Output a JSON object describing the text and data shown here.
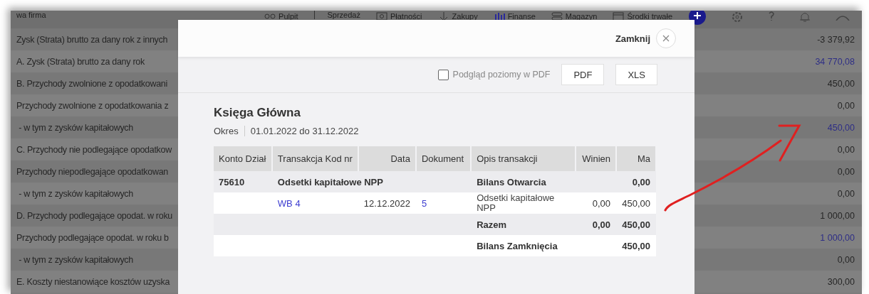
{
  "top_nav": {
    "company": "wa firma",
    "items": [
      {
        "kind": "desk",
        "label": "Pulpit"
      },
      {
        "kind": "none",
        "label": "Sprzedaż"
      },
      {
        "kind": "payment",
        "label": "Płatności"
      },
      {
        "kind": "down",
        "label": "Zakupy"
      },
      {
        "kind": "bars",
        "label": "Finanse"
      },
      {
        "kind": "stack",
        "label": "Magazyn"
      },
      {
        "kind": "calendar",
        "label": "Środki trwałe"
      }
    ]
  },
  "report_rows": [
    {
      "label": "Zysk (Strata) brutto za dany rok z innych",
      "value": "-3 379,92",
      "link": false
    },
    {
      "label": "A. Zysk (Strata) brutto za dany rok",
      "value": "34 770,08",
      "link": true
    },
    {
      "label": "B. Przychody zwolnione z opodatkowani",
      "value": "450,00",
      "link": false
    },
    {
      "label": "Przychody zwolnione z opodatkowania z",
      "value": "0,00",
      "link": false
    },
    {
      "label": " - w tym z zysków kapitałowych",
      "value": "450,00",
      "link": true
    },
    {
      "label": "C. Przychody nie podlegające opodatkow",
      "value": "0,00",
      "link": false
    },
    {
      "label": "Przychody niepodlegające opodatkowan",
      "value": "0,00",
      "link": false
    },
    {
      "label": " - w tym z zysków kapitałowych",
      "value": "0,00",
      "link": false
    },
    {
      "label": "D. Przychody podlegające opodat. w roku",
      "value": "1 000,00",
      "link": false
    },
    {
      "label": "Przychody podlegające opodat. w roku b",
      "value": "1 000,00",
      "link": true
    },
    {
      "label": " - w tym z zysków kapitałowych",
      "value": "0,00",
      "link": false
    },
    {
      "label": "E. Koszty niestanowiące kosztów uzyska",
      "value": "300,00",
      "link": false
    }
  ],
  "modal": {
    "close_label": "Zamknij",
    "landscape_pdf": {
      "label": "Podgląd poziomy w PDF",
      "checked": false
    },
    "buttons": [
      "PDF",
      "XLS"
    ],
    "title": "Księga Główna",
    "period_label": "Okres",
    "period": "01.01.2022 do 31.12.2022",
    "table": {
      "columns": [
        "Konto Dział",
        "Transakcja Kod nr",
        "Data",
        "Dokument",
        "Opis transakcji",
        "Winien",
        "Ma"
      ],
      "rows": [
        {
          "kind": "account",
          "konto": "75610",
          "transakcja": "Odsetki kapitałowe NPP",
          "opis": "Bilans Otwarcia",
          "ma": "0,00"
        },
        {
          "kind": "transaction",
          "transakcja": "WB 4",
          "data": "12.12.2022",
          "dokument": "5",
          "opis": "Odsetki kapitałowe NPP",
          "winien": "0,00",
          "ma": "450,00"
        },
        {
          "kind": "total",
          "opis": "Razem",
          "winien": "0,00",
          "ma": "450,00"
        },
        {
          "kind": "closing",
          "opis": "Bilans Zamknięcia",
          "ma": "450,00"
        }
      ]
    }
  }
}
